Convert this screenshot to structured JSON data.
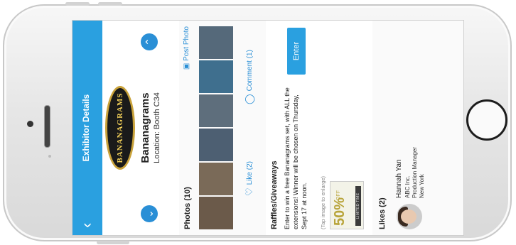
{
  "header": {
    "title": "Exhibitor Details",
    "back_icon": "chevron-left-icon"
  },
  "exhibitor": {
    "logo_text": "BANANAGRAMS",
    "name": "Bananagrams",
    "location": "Location: Booth C34"
  },
  "photos": {
    "title": "Photos (10)",
    "post_label": "Post Photo",
    "thumb_colors": [
      "#6b5a4a",
      "#7a6a58",
      "#4d5f72",
      "#5e6e7c",
      "#3f6f8e",
      "#55697a"
    ],
    "like_label": "Like (2)",
    "comment_label": "Comment (1)"
  },
  "raffles": {
    "title": "Raffles/Giveaways",
    "description": "Enter to win a free Bananagrams set, with ALL the extensions! Winner will be chosen on Thursday, Sept 17 at noon.",
    "tap_hint": "(Tap image to enlarge)",
    "coupon_big": "50%",
    "coupon_small": "OFF",
    "coupon_tag": "LIMITED TIME",
    "enter_label": "Enter"
  },
  "likes": {
    "title": "Likes (2)",
    "users": [
      {
        "name": "Hannah Yan",
        "company": "ABC Inc.",
        "role": "Production Manager",
        "city": "New York"
      }
    ]
  },
  "colors": {
    "accent": "#2aa0e0",
    "nav_arrow": "#2a8fd6"
  }
}
